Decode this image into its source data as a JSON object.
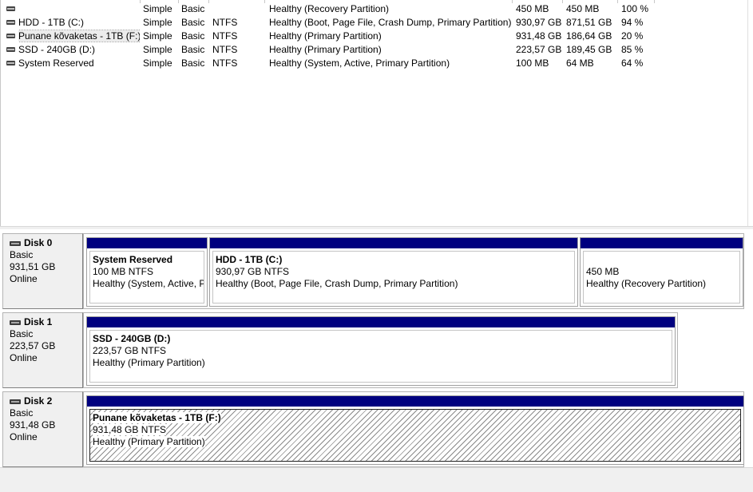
{
  "volumes": [
    {
      "name": "",
      "layout": "Simple",
      "type": "Basic",
      "fs": "",
      "status": "Healthy (Recovery Partition)",
      "capacity": "450 MB",
      "free": "450 MB",
      "pct": "100 %"
    },
    {
      "name": "HDD - 1TB (C:)",
      "layout": "Simple",
      "type": "Basic",
      "fs": "NTFS",
      "status": "Healthy (Boot, Page File, Crash Dump, Primary Partition)",
      "capacity": "930,97 GB",
      "free": "871,51 GB",
      "pct": "94 %"
    },
    {
      "name": "Punane kõvaketas - 1TB (F:)",
      "layout": "Simple",
      "type": "Basic",
      "fs": "NTFS",
      "status": "Healthy (Primary Partition)",
      "capacity": "931,48 GB",
      "free": "186,64 GB",
      "pct": "20 %"
    },
    {
      "name": "SSD - 240GB (D:)",
      "layout": "Simple",
      "type": "Basic",
      "fs": "NTFS",
      "status": "Healthy (Primary Partition)",
      "capacity": "223,57 GB",
      "free": "189,45 GB",
      "pct": "85 %"
    },
    {
      "name": "System Reserved",
      "layout": "Simple",
      "type": "Basic",
      "fs": "NTFS",
      "status": "Healthy (System, Active, Primary Partition)",
      "capacity": "100 MB",
      "free": "64 MB",
      "pct": "64 %"
    }
  ],
  "disks": [
    {
      "name": "Disk 0",
      "type": "Basic",
      "size": "931,51 GB",
      "state": "Online",
      "partitions": [
        {
          "name": "System Reserved",
          "size": "100 MB NTFS",
          "status": "Healthy (System, Active, P"
        },
        {
          "name": "HDD - 1TB  (C:)",
          "size": "930,97 GB NTFS",
          "status": "Healthy (Boot, Page File, Crash Dump, Primary Partition)"
        },
        {
          "name": "",
          "size": "450 MB",
          "status": "Healthy (Recovery Partition)"
        }
      ]
    },
    {
      "name": "Disk 1",
      "type": "Basic",
      "size": "223,57 GB",
      "state": "Online",
      "partitions": [
        {
          "name": "SSD - 240GB  (D:)",
          "size": "223,57 GB NTFS",
          "status": "Healthy (Primary Partition)"
        }
      ]
    },
    {
      "name": "Disk 2",
      "type": "Basic",
      "size": "931,48 GB",
      "state": "Online",
      "partitions": [
        {
          "name": "Punane kõvaketas - 1TB  (F:)",
          "size": "931,48 GB NTFS",
          "status": "Healthy (Primary Partition)"
        }
      ]
    }
  ],
  "colors": {
    "partition_bar": "#00007f",
    "selection_hatch": "#8a8a8a"
  },
  "icons": {
    "volume": "volume-drive-icon",
    "disk": "disk-drive-icon"
  }
}
